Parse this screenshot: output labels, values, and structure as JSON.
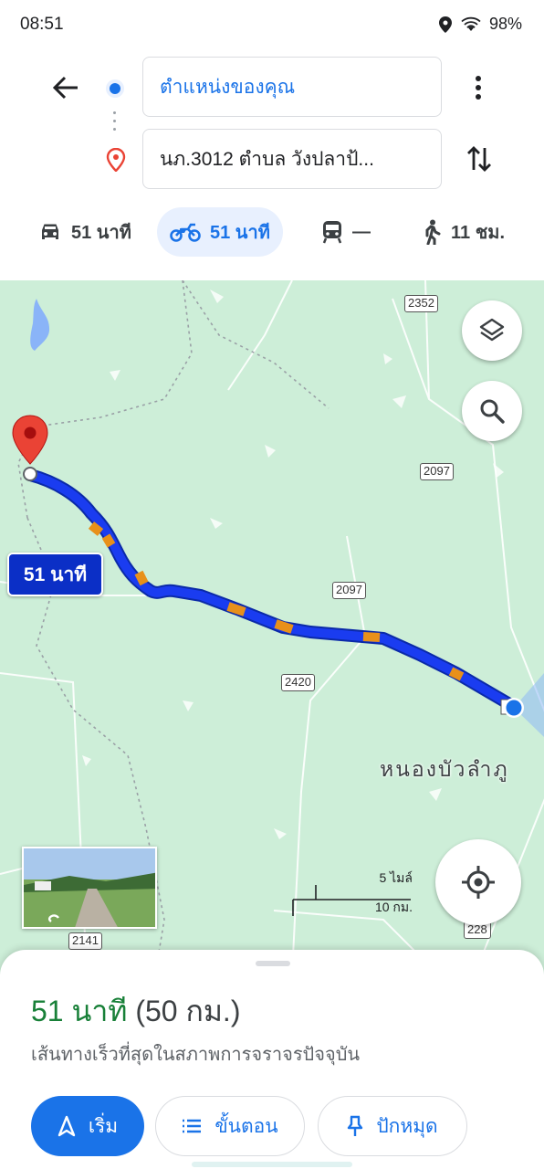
{
  "status_bar": {
    "time": "08:51",
    "battery": "98%",
    "icons": [
      "location-icon",
      "wifi-icon"
    ]
  },
  "directions": {
    "origin": "ตำแหน่งของคุณ",
    "destination": "นภ.3012 ตำบล วังปลาป้..."
  },
  "modes": [
    {
      "icon": "car-icon",
      "label": "51 นาที",
      "active": false
    },
    {
      "icon": "motorcycle-icon",
      "label": "51 นาที",
      "active": true
    },
    {
      "icon": "transit-icon",
      "label": "—",
      "active": false
    },
    {
      "icon": "walk-icon",
      "label": "11 ชม.",
      "active": false
    }
  ],
  "map": {
    "route_label": "51 นาที",
    "town": "หนองบัวลำภู",
    "road_shields": [
      "2352",
      "2097",
      "2097",
      "2420",
      "2141",
      "228"
    ],
    "scale": {
      "imperial": "5 ไมล์",
      "metric": "10 กม."
    },
    "colors": {
      "route": "#1a3cf0",
      "route_slow": "#e8901a",
      "land": "#cdeed8",
      "pin": "#ea4335"
    }
  },
  "sheet": {
    "eta": "51 นาที",
    "distance": "(50 กม.)",
    "description": "เส้นทางเร็วที่สุดในสภาพการจราจรปัจจุบัน",
    "start_label": "เริ่ม",
    "steps_label": "ขั้นตอน",
    "pin_label": "ปักหมุด"
  }
}
